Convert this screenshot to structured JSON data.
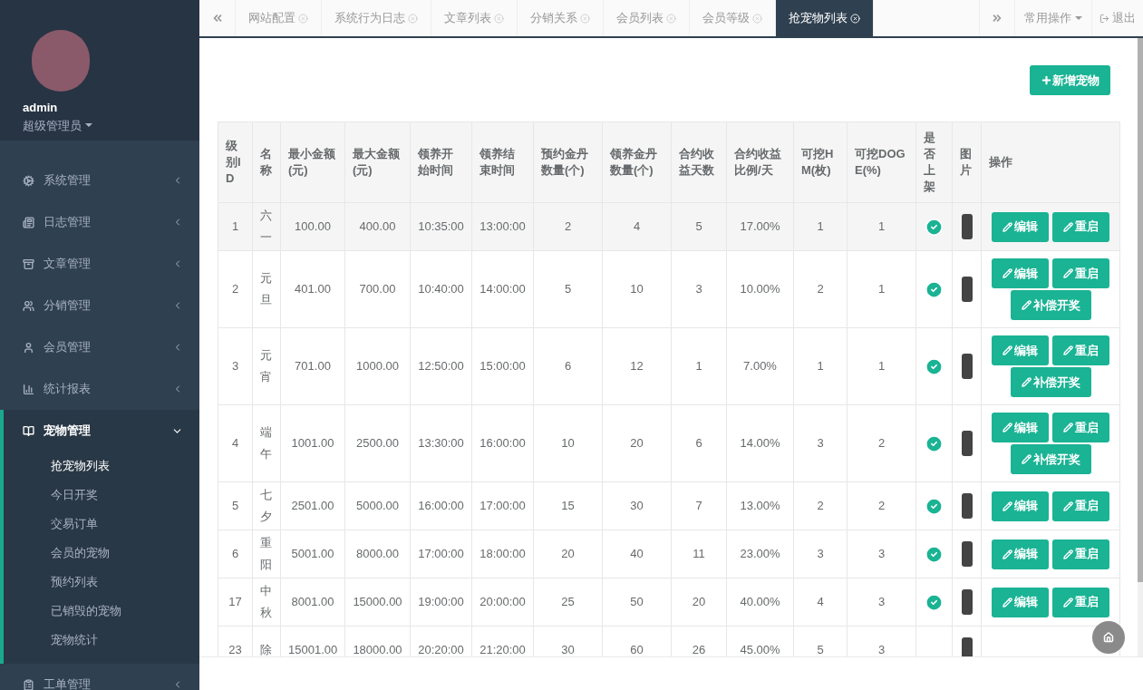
{
  "sidebar": {
    "user": {
      "name": "admin",
      "role": "超级管理员"
    },
    "menu": [
      {
        "label": "系统管理",
        "expanded": false
      },
      {
        "label": "日志管理",
        "expanded": false
      },
      {
        "label": "文章管理",
        "expanded": false
      },
      {
        "label": "分销管理",
        "expanded": false
      },
      {
        "label": "会员管理",
        "expanded": false
      },
      {
        "label": "统计报表",
        "expanded": false
      },
      {
        "label": "宠物管理",
        "expanded": true,
        "children": [
          {
            "label": "抢宠物列表",
            "selected": true
          },
          {
            "label": "今日开奖",
            "selected": false
          },
          {
            "label": "交易订单",
            "selected": false
          },
          {
            "label": "会员的宠物",
            "selected": false
          },
          {
            "label": "预约列表",
            "selected": false
          },
          {
            "label": "已销毁的宠物",
            "selected": false
          },
          {
            "label": "宠物统计",
            "selected": false
          }
        ]
      },
      {
        "label": "工单管理",
        "expanded": false
      }
    ]
  },
  "tabs": [
    {
      "label": "网站配置",
      "selected": false
    },
    {
      "label": "系统行为日志",
      "selected": false
    },
    {
      "label": "文章列表",
      "selected": false
    },
    {
      "label": "分销关系",
      "selected": false
    },
    {
      "label": "会员列表",
      "selected": false
    },
    {
      "label": "会员等级",
      "selected": false
    },
    {
      "label": "抢宠物列表",
      "selected": true
    }
  ],
  "toolbar": {
    "common_ops": "常用操作",
    "logout": "退出"
  },
  "add_button": "新增宠物",
  "table": {
    "columns": [
      "级别ID",
      "名称",
      "最小金额(元)",
      "最大金额(元)",
      "领养开始时间",
      "领养结束时间",
      "预约金丹数量(个)",
      "领养金丹数量(个)",
      "合约收益天数",
      "合约收益比例/天",
      "可挖HM(枚)",
      "可挖DOGE(%)",
      "是否上架",
      "图片",
      "操作"
    ],
    "rows": [
      {
        "cells": [
          "1",
          "六一",
          "100.00",
          "400.00",
          "10:35:00",
          "13:00:00",
          "2",
          "4",
          "5",
          "17.00%",
          "1",
          "1"
        ],
        "listed": true,
        "image": true,
        "actions": [
          "编辑",
          "重启"
        ]
      },
      {
        "cells": [
          "2",
          "元旦",
          "401.00",
          "700.00",
          "10:40:00",
          "14:00:00",
          "5",
          "10",
          "3",
          "10.00%",
          "2",
          "1"
        ],
        "listed": true,
        "image": true,
        "actions": [
          "编辑",
          "重启",
          "补偿开奖"
        ]
      },
      {
        "cells": [
          "3",
          "元宵",
          "701.00",
          "1000.00",
          "12:50:00",
          "15:00:00",
          "6",
          "12",
          "1",
          "7.00%",
          "1",
          "1"
        ],
        "listed": true,
        "image": true,
        "actions": [
          "编辑",
          "重启",
          "补偿开奖"
        ]
      },
      {
        "cells": [
          "4",
          "端午",
          "1001.00",
          "2500.00",
          "13:30:00",
          "16:00:00",
          "10",
          "20",
          "6",
          "14.00%",
          "3",
          "2"
        ],
        "listed": true,
        "image": true,
        "actions": [
          "编辑",
          "重启",
          "补偿开奖"
        ]
      },
      {
        "cells": [
          "5",
          "七夕",
          "2501.00",
          "5000.00",
          "16:00:00",
          "17:00:00",
          "15",
          "30",
          "7",
          "13.00%",
          "2",
          "2"
        ],
        "listed": true,
        "image": true,
        "actions": [
          "编辑",
          "重启"
        ]
      },
      {
        "cells": [
          "6",
          "重阳",
          "5001.00",
          "8000.00",
          "17:00:00",
          "18:00:00",
          "20",
          "40",
          "11",
          "23.00%",
          "3",
          "3"
        ],
        "listed": true,
        "image": true,
        "actions": [
          "编辑",
          "重启"
        ]
      },
      {
        "cells": [
          "17",
          "中秋",
          "8001.00",
          "15000.00",
          "19:00:00",
          "20:00:00",
          "25",
          "50",
          "20",
          "40.00%",
          "4",
          "3"
        ],
        "listed": true,
        "image": true,
        "actions": [
          "编辑",
          "重启"
        ]
      },
      {
        "cells": [
          "23",
          "除",
          "15001.00",
          "18000.00",
          "20:20:00",
          "21:20:00",
          "30",
          "60",
          "26",
          "45.00%",
          "5",
          "3"
        ],
        "listed": false,
        "image": true
      }
    ]
  }
}
